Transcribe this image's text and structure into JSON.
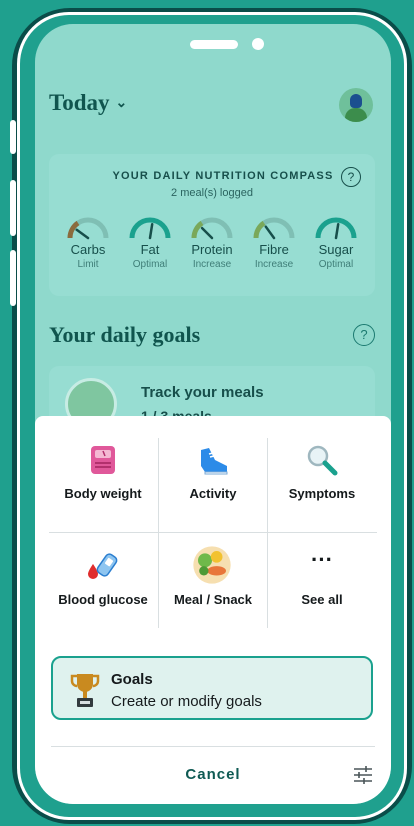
{
  "header": {
    "title": "Today",
    "dropdown_icon": "chevron-down-icon"
  },
  "compass": {
    "title": "YOUR DAILY NUTRITION COMPASS",
    "subtitle": "2 meal(s) logged",
    "gauges": [
      {
        "name": "Carbs",
        "status": "Limit",
        "level": 0.2
      },
      {
        "name": "Fat",
        "status": "Optimal",
        "level": 0.55
      },
      {
        "name": "Protein",
        "status": "Increase",
        "level": 0.25
      },
      {
        "name": "Fibre",
        "status": "Increase",
        "level": 0.3
      },
      {
        "name": "Sugar",
        "status": "Optimal",
        "level": 0.55
      }
    ]
  },
  "goals_section": {
    "heading": "Your daily goals"
  },
  "track_card": {
    "title": "Track your meals",
    "count": "1 / 3 meals"
  },
  "sheet": {
    "items": [
      {
        "label": "Body weight",
        "icon": "scale-icon"
      },
      {
        "label": "Activity",
        "icon": "sneaker-icon"
      },
      {
        "label": "Symptoms",
        "icon": "magnifier-icon"
      },
      {
        "label": "Blood glucose",
        "icon": "glucose-meter-icon"
      },
      {
        "label": "Meal / Snack",
        "icon": "meal-plate-icon"
      },
      {
        "label": "See all",
        "icon": "more-dots-icon"
      }
    ],
    "goals_title": "Goals",
    "goals_subtitle": "Create or modify goals",
    "cancel_label": "Cancel",
    "more_glyph": "···"
  },
  "colors": {
    "brand_teal": "#1fa08e",
    "dark_teal": "#10554e",
    "gauge_green": "#1aa18e",
    "gauge_brown": "#8b6b3d"
  }
}
